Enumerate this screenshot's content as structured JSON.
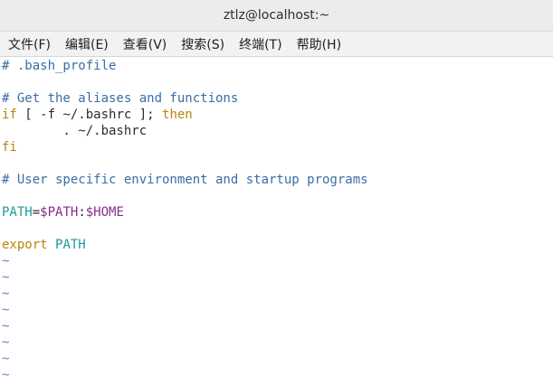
{
  "window": {
    "title": "ztlz@localhost:~"
  },
  "menu": [
    {
      "id": "file",
      "label": "文件(F)"
    },
    {
      "id": "edit",
      "label": "编辑(E)"
    },
    {
      "id": "view",
      "label": "查看(V)"
    },
    {
      "id": "search",
      "label": "搜索(S)"
    },
    {
      "id": "terminal",
      "label": "终端(T)"
    },
    {
      "id": "help",
      "label": "帮助(H)"
    }
  ],
  "editor": {
    "lines": [
      {
        "segments": [
          {
            "text": "# .bash_profile",
            "kind": "comment"
          }
        ]
      },
      {
        "segments": []
      },
      {
        "segments": [
          {
            "text": "# Get the aliases and functions",
            "kind": "comment"
          }
        ]
      },
      {
        "segments": [
          {
            "text": "if",
            "kind": "keyword"
          },
          {
            "text": " [ -f ",
            "kind": "plain"
          },
          {
            "text": "~/.bashrc",
            "kind": "plain"
          },
          {
            "text": " ]; ",
            "kind": "plain"
          },
          {
            "text": "then",
            "kind": "keyword"
          }
        ]
      },
      {
        "segments": [
          {
            "text": "        . ~/.bashrc",
            "kind": "plain"
          }
        ]
      },
      {
        "segments": [
          {
            "text": "fi",
            "kind": "keyword"
          }
        ]
      },
      {
        "segments": []
      },
      {
        "segments": [
          {
            "text": "# User specific environment and startup programs",
            "kind": "comment"
          }
        ]
      },
      {
        "segments": []
      },
      {
        "segments": [
          {
            "text": "PATH",
            "kind": "var"
          },
          {
            "text": "=",
            "kind": "plain"
          },
          {
            "text": "$PATH",
            "kind": "dollar"
          },
          {
            "text": ":",
            "kind": "plain"
          },
          {
            "text": "$HOME",
            "kind": "dollar"
          }
        ]
      },
      {
        "segments": []
      },
      {
        "segments": [
          {
            "text": "export",
            "kind": "keyword"
          },
          {
            "text": " ",
            "kind": "plain"
          },
          {
            "text": "PATH",
            "kind": "var"
          }
        ]
      }
    ],
    "tilde_marker": "~",
    "tilde_count": 8
  },
  "colors": {
    "comment": "#3a6ea5",
    "keyword": "#b8860b",
    "variable": "#1a9a9a",
    "dollar": "#8a2b8a",
    "tilde": "#5a8ac8"
  }
}
